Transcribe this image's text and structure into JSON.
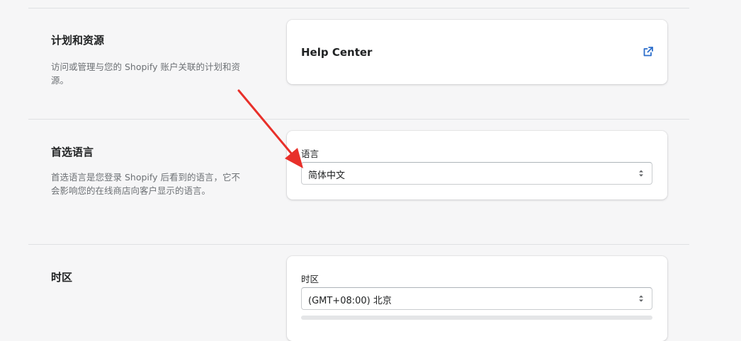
{
  "sections": {
    "plans": {
      "title": "计划和资源",
      "description": "访问或管理与您的 Shopify 账户关联的计划和资源。",
      "link_label": "Help Center",
      "link_icon": "external-link-icon"
    },
    "language": {
      "title": "首选语言",
      "description": "首选语言是您登录 Shopify 后看到的语言，它不会影响您的在线商店向客户显示的语言。",
      "field_label": "语言",
      "selected": "简体中文"
    },
    "timezone": {
      "title": "时区",
      "field_label": "时区",
      "selected": "(GMT+08:00) 北京"
    }
  },
  "colors": {
    "background": "#f6f6f7",
    "card": "#ffffff",
    "link_icon": "#2c6ecb",
    "annotation_arrow": "#e8302a",
    "muted_text": "#6d7175"
  }
}
